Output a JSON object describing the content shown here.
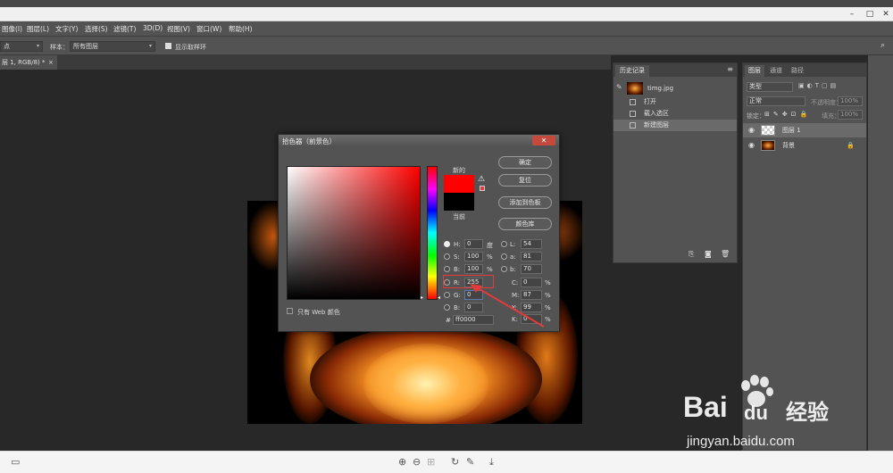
{
  "menubar": {
    "items": [
      "图像(I)",
      "图层(L)",
      "文字(Y)",
      "选择(S)",
      "滤镜(T)",
      "3D(D)",
      "视图(V)",
      "窗口(W)",
      "帮助(H)"
    ]
  },
  "options": {
    "point_select": "点",
    "sample_label": "样本：",
    "sample_select": "所有图层",
    "show_ring_label": "显示取样环"
  },
  "document": {
    "tab_label": "层 1, RGB/8) *"
  },
  "history": {
    "tab": "历史记录",
    "snapshot": "timg.jpg",
    "rows": [
      "打开",
      "载入选区",
      "新建图层"
    ]
  },
  "layers": {
    "tabs": [
      "图层",
      "通道",
      "路径"
    ],
    "kind_placeholder": "类型",
    "blend_mode": "正常",
    "opacity_label": "不透明度：",
    "opacity_value": "100%",
    "lock_label": "锁定：",
    "fill_label": "填充：",
    "fill_value": "100%",
    "rows": [
      "图层 1",
      "背景"
    ]
  },
  "picker": {
    "title": "拾色器（前景色）",
    "new_label": "新的",
    "current_label": "当前",
    "buttons": [
      "确定",
      "复位",
      "添加到色板",
      "颜色库"
    ],
    "web_only_label": "只有 Web 颜色",
    "hsb": [
      {
        "label": "H:",
        "value": "0",
        "unit": "度"
      },
      {
        "label": "S:",
        "value": "100",
        "unit": "%"
      },
      {
        "label": "B:",
        "value": "100",
        "unit": "%"
      }
    ],
    "rgb": [
      {
        "label": "R:",
        "value": "255"
      },
      {
        "label": "G:",
        "value": "0"
      },
      {
        "label": "B:",
        "value": "0"
      }
    ],
    "lab": [
      {
        "label": "L:",
        "value": "54"
      },
      {
        "label": "a:",
        "value": "81"
      },
      {
        "label": "b:",
        "value": "70"
      }
    ],
    "cmyk": [
      {
        "label": "C:",
        "value": "0",
        "unit": "%"
      },
      {
        "label": "M:",
        "value": "87",
        "unit": "%"
      },
      {
        "label": "Y:",
        "value": "99",
        "unit": "%"
      },
      {
        "label": "K:",
        "value": "0",
        "unit": "%"
      }
    ],
    "hex_label": "#",
    "hex_value": "ff0000",
    "new_color": "#ff0000",
    "current_color": "#000000"
  },
  "watermark": {
    "brand": "Bai",
    "brand2": "du",
    "cn": "经验",
    "url": "jingyan.baidu.com"
  }
}
